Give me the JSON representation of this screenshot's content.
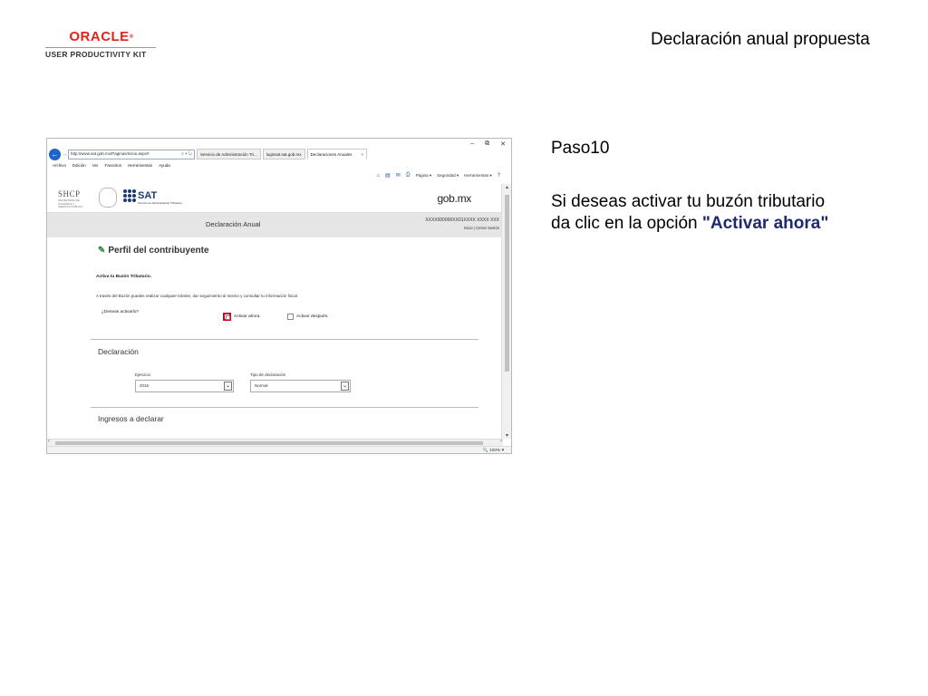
{
  "logo": {
    "brand": "ORACLE",
    "product": "USER PRODUCTIVITY KIT"
  },
  "slide": {
    "title": "Declaración anual propuesta",
    "step": "Paso10",
    "instruction_line1": "Si deseas activar tu buzón tributario",
    "instruction_line2": "da  clic en la opción ",
    "instruction_highlight": "\"Activar ahora\""
  },
  "browser": {
    "win_min": "–",
    "win_restore": "⧉",
    "win_close": "✕",
    "address": "http://www.sat.gob.mx/Paginas/Inicio.aspx#",
    "tabs": [
      {
        "label": "Servicio de Administración Tri..."
      },
      {
        "label": "loginsat.sat.gob.mx"
      },
      {
        "label": "Declaraciones Anuales"
      }
    ],
    "menu": [
      "Archivo",
      "Edición",
      "Ver",
      "Favoritos",
      "Herramientas",
      "Ayuda"
    ],
    "commands": [
      "Página ▾",
      "Seguridad ▾",
      "Herramientas ▾"
    ],
    "zoom": "🔍 100% ▾"
  },
  "page": {
    "shcp": "SHCP",
    "shcp_sub": "SECRETARÍA DE HACIENDA Y CRÉDITO PÚBLICO",
    "sat": "SAT",
    "sat_sub": "Servicio de Administración Tributaria",
    "gobmx": "gob.mx",
    "decl_title": "Declaración Anual",
    "rfc": "XXXX000000XX01XXXX XXXX XXX",
    "session": "Inicio | Cerrar Sesión",
    "perfil_title": "Perfil del contribuyente",
    "buzon_title": "Activa tu Buzón Tributario.",
    "buzon_desc": "A través del Buzón puedes realizar cualquier trámite, dar seguimiento al mismo y consultar tu información fiscal.",
    "question": "¿Deseas activarlo?",
    "option_now": "Activar ahora.",
    "option_later": "Activar después.",
    "section_declaracion": "Declaración",
    "ejercicio_label": "Ejercicio",
    "ejercicio_value": "2016",
    "tipo_label": "Tipo de declaración",
    "tipo_value": "Normal",
    "section_ingresos": "Ingresos a declarar"
  }
}
